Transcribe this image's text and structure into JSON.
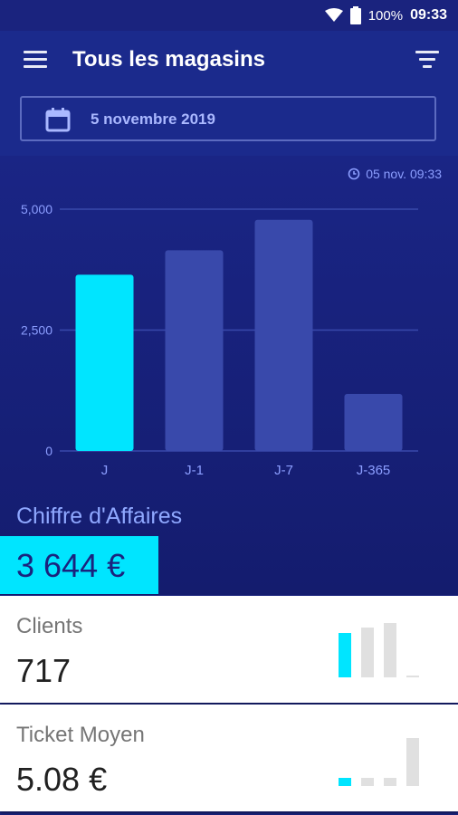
{
  "status": {
    "battery": "100%",
    "time": "09:33"
  },
  "appbar": {
    "title": "Tous les magasins",
    "menu_icon": "hamburger-menu-icon",
    "filter_icon": "filter-list-icon"
  },
  "date_selector": {
    "value": "5 novembre 2019",
    "icon": "calendar-icon"
  },
  "chart_data": {
    "type": "bar",
    "timestamp": "05 nov. 09:33",
    "categories": [
      "J",
      "J-1",
      "J-7",
      "J-365"
    ],
    "values": [
      3644,
      4150,
      4780,
      1180
    ],
    "ylim": [
      0,
      5000
    ],
    "yticks": [
      0,
      2500,
      5000
    ],
    "ytick_labels": [
      "0",
      "2,500",
      "5,000"
    ],
    "grid": true,
    "colors": {
      "highlight": "#00e5ff",
      "bar": "#3949ab",
      "grid": "#3949ab",
      "axis_text": "#8c9eff"
    }
  },
  "summary": {
    "label": "Chiffre d'Affaires",
    "value": "3 644 €"
  },
  "cards": [
    {
      "label": "Clients",
      "value": "717",
      "trend": [
        0.82,
        0.92,
        1.0,
        0.04
      ]
    },
    {
      "label": "Ticket Moyen",
      "value": "5.08 €",
      "trend": [
        0.15,
        0.15,
        0.15,
        0.88
      ]
    }
  ],
  "colors": {
    "accent": "#00e5ff",
    "primary": "#1a237e",
    "mini_gray": "#e0e0e0"
  }
}
